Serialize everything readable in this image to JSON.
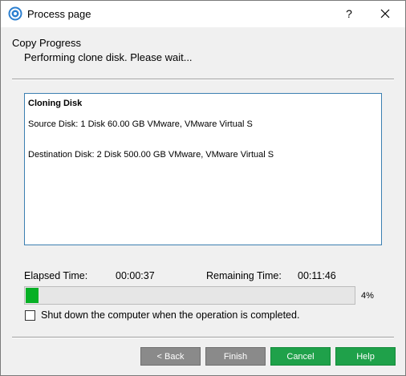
{
  "window": {
    "title": "Process page",
    "help_glyph": "?"
  },
  "header": {
    "title": "Copy Progress",
    "subtitle": "Performing clone disk. Please wait..."
  },
  "info": {
    "heading": "Cloning Disk",
    "source": "Source Disk: 1 Disk 60.00 GB VMware, VMware Virtual S",
    "destination": "Destination Disk: 2 Disk 500.00 GB VMware, VMware Virtual S"
  },
  "timing": {
    "elapsed_label": "Elapsed Time:",
    "elapsed_value": "00:00:37",
    "remaining_label": "Remaining Time:",
    "remaining_value": "00:11:46"
  },
  "progress": {
    "percent": 4,
    "percent_label": "4%"
  },
  "shutdown": {
    "label": "Shut down the computer when the operation is completed.",
    "checked": false
  },
  "buttons": {
    "back": "< Back",
    "finish": "Finish",
    "cancel": "Cancel",
    "help": "Help"
  },
  "colors": {
    "progress_fill": "#06b025",
    "green_button": "#1fa14a",
    "disabled_button": "#8a8a8a",
    "box_border": "#3c7fb1"
  },
  "icons": {
    "app": "minitool-app-icon",
    "close": "close-icon"
  }
}
